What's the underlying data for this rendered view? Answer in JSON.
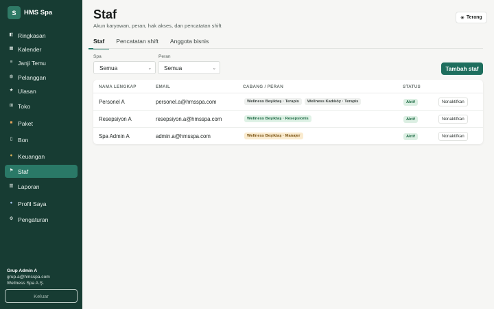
{
  "brand": {
    "logo_letter": "S",
    "name": "HMS Spa"
  },
  "sidebar": {
    "items": [
      {
        "label": "Ringkasan",
        "icon": "dashboard-icon"
      },
      {
        "label": "Kalender",
        "icon": "calendar-icon"
      },
      {
        "label": "Janji Temu",
        "icon": "list-icon"
      },
      {
        "label": "Pelanggan",
        "icon": "customers-icon"
      },
      {
        "label": "Ulasan",
        "icon": "star-icon"
      },
      {
        "label": "Toko",
        "icon": "cart-icon"
      },
      {
        "label": "Paket",
        "icon": "package-icon"
      },
      {
        "label": "Bon",
        "icon": "receipt-icon"
      },
      {
        "label": "Keuangan",
        "icon": "money-bag-icon"
      },
      {
        "label": "Staf",
        "icon": "flag-icon",
        "active": true
      },
      {
        "label": "Laporan",
        "icon": "chart-icon"
      },
      {
        "label": "Profil Saya",
        "icon": "user-icon"
      },
      {
        "label": "Pengaturan",
        "icon": "gear-icon"
      }
    ]
  },
  "user": {
    "name": "Grup Admin A",
    "email": "grup.a@hmsspa.com",
    "company": "Wellness Spa A.Ş."
  },
  "logout_label": "Keluar",
  "header": {
    "title": "Staf",
    "subtitle": "Akun karyawan, peran, hak akses, dan pencatatan shift",
    "theme_label": "Terang"
  },
  "tabs": [
    {
      "label": "Staf",
      "active": true
    },
    {
      "label": "Pencatatan shift"
    },
    {
      "label": "Anggota bisnis"
    }
  ],
  "filters": {
    "spa": {
      "label": "Spa",
      "value": "Semua"
    },
    "role": {
      "label": "Peran",
      "value": "Semua"
    }
  },
  "add_button_label": "Tambah staf",
  "table": {
    "headers": {
      "name": "NAMA LENGKAP",
      "email": "EMAIL",
      "branch_role": "CABANG / PERAN",
      "status": "STATUS"
    },
    "rows": [
      {
        "name": "Personel A",
        "email": "personel.a@hmsspa.com",
        "chips": [
          "Wellness Beşiktaş · Terapis",
          "Wellness Kadıköy · Terapis"
        ],
        "status": "Aktif",
        "action": "Nonaktifkan"
      },
      {
        "name": "Resepsiyon A",
        "email": "resepsiyon.a@hmsspa.com",
        "chips": [
          "Wellness Beşiktaş · Resepsionis"
        ],
        "status": "Aktif",
        "action": "Nonaktifkan"
      },
      {
        "name": "Spa Admin A",
        "email": "admin.a@hmsspa.com",
        "chips": [
          "Wellness Beşiktaş · Manajer"
        ],
        "status": "Aktif",
        "action": "Nonaktifkan"
      }
    ]
  },
  "colors": {
    "sidebar_bg": "#173c33",
    "accent": "#1e6e5d",
    "active_nav": "#2a7967"
  }
}
